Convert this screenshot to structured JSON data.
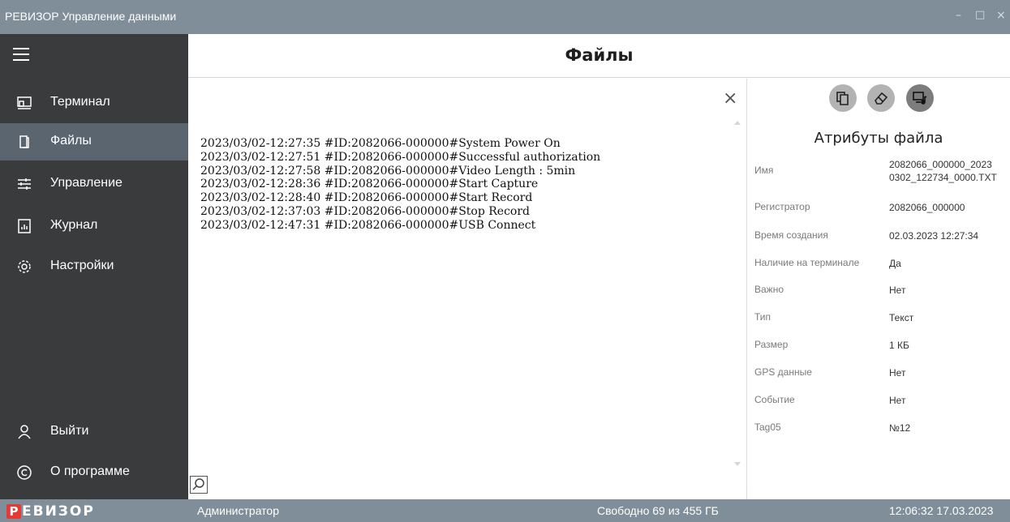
{
  "window": {
    "title": "РЕВИЗОР Управление данными",
    "controls": {
      "minimize": "–",
      "maximize": "□",
      "close": "×"
    }
  },
  "sidebar": {
    "menu_icon": "hamburger-icon",
    "items": [
      {
        "label": "Терминал",
        "icon": "terminal-icon",
        "active": false
      },
      {
        "label": "Файлы",
        "icon": "file-icon",
        "active": true
      },
      {
        "label": "Управление",
        "icon": "sliders-icon",
        "active": false
      },
      {
        "label": "Журнал",
        "icon": "chart-doc-icon",
        "active": false
      },
      {
        "label": "Настройки",
        "icon": "gear-icon",
        "active": false
      }
    ],
    "bottom_items": [
      {
        "label": "Выйти",
        "icon": "user-icon"
      },
      {
        "label": "О программе",
        "icon": "copyright-icon"
      }
    ]
  },
  "main": {
    "title": "Файлы",
    "close_symbol": "×",
    "log_lines": [
      "2023/03/02-12:27:35 #ID:2082066-000000#System Power On",
      "2023/03/02-12:27:51 #ID:2082066-000000#Successful authorization",
      "2023/03/02-12:27:58 #ID:2082066-000000#Video Length : 5min",
      "2023/03/02-12:28:36 #ID:2082066-000000#Start Capture",
      "2023/03/02-12:28:40 #ID:2082066-000000#Start Record",
      "2023/03/02-12:37:03 #ID:2082066-000000#Stop Record",
      "2023/03/02-12:47:31 #ID:2082066-000000#USB Connect"
    ],
    "search_icon": "search-icon"
  },
  "attributes": {
    "title": "Атрибуты файла",
    "action_icons": [
      "copy-icon",
      "erase-icon",
      "media-player-icon"
    ],
    "rows": [
      {
        "key": "Имя",
        "value": [
          "2082066_000000_2023",
          "0302_122734_0000.TXT"
        ]
      },
      {
        "key": "Регистратор",
        "value": "2082066_000000"
      },
      {
        "key": "Время создания",
        "value": "02.03.2023 12:27:34"
      },
      {
        "key": "Наличие на терминале",
        "value": "Да"
      },
      {
        "key": "Важно",
        "value": "Нет"
      },
      {
        "key": "Тип",
        "value": "Текст"
      },
      {
        "key": "Размер",
        "value": "1 КБ"
      },
      {
        "key": "GPS данные",
        "value": "Нет"
      },
      {
        "key": "Событие",
        "value": "Нет"
      },
      {
        "key": "Tag05",
        "value": "№12"
      }
    ]
  },
  "status": {
    "logo_letter": "Р",
    "logo_rest": "ЕВИЗОР",
    "brand_color": "#e53935",
    "user": "Администратор",
    "free_space": "Свободно 69 из 455 ГБ",
    "datetime": "12:06:32 17.03.2023"
  },
  "colors": {
    "titlebar": "#7f8e99",
    "sidebar": "#3a3b3c",
    "sidebar_active": "#5a6570"
  }
}
